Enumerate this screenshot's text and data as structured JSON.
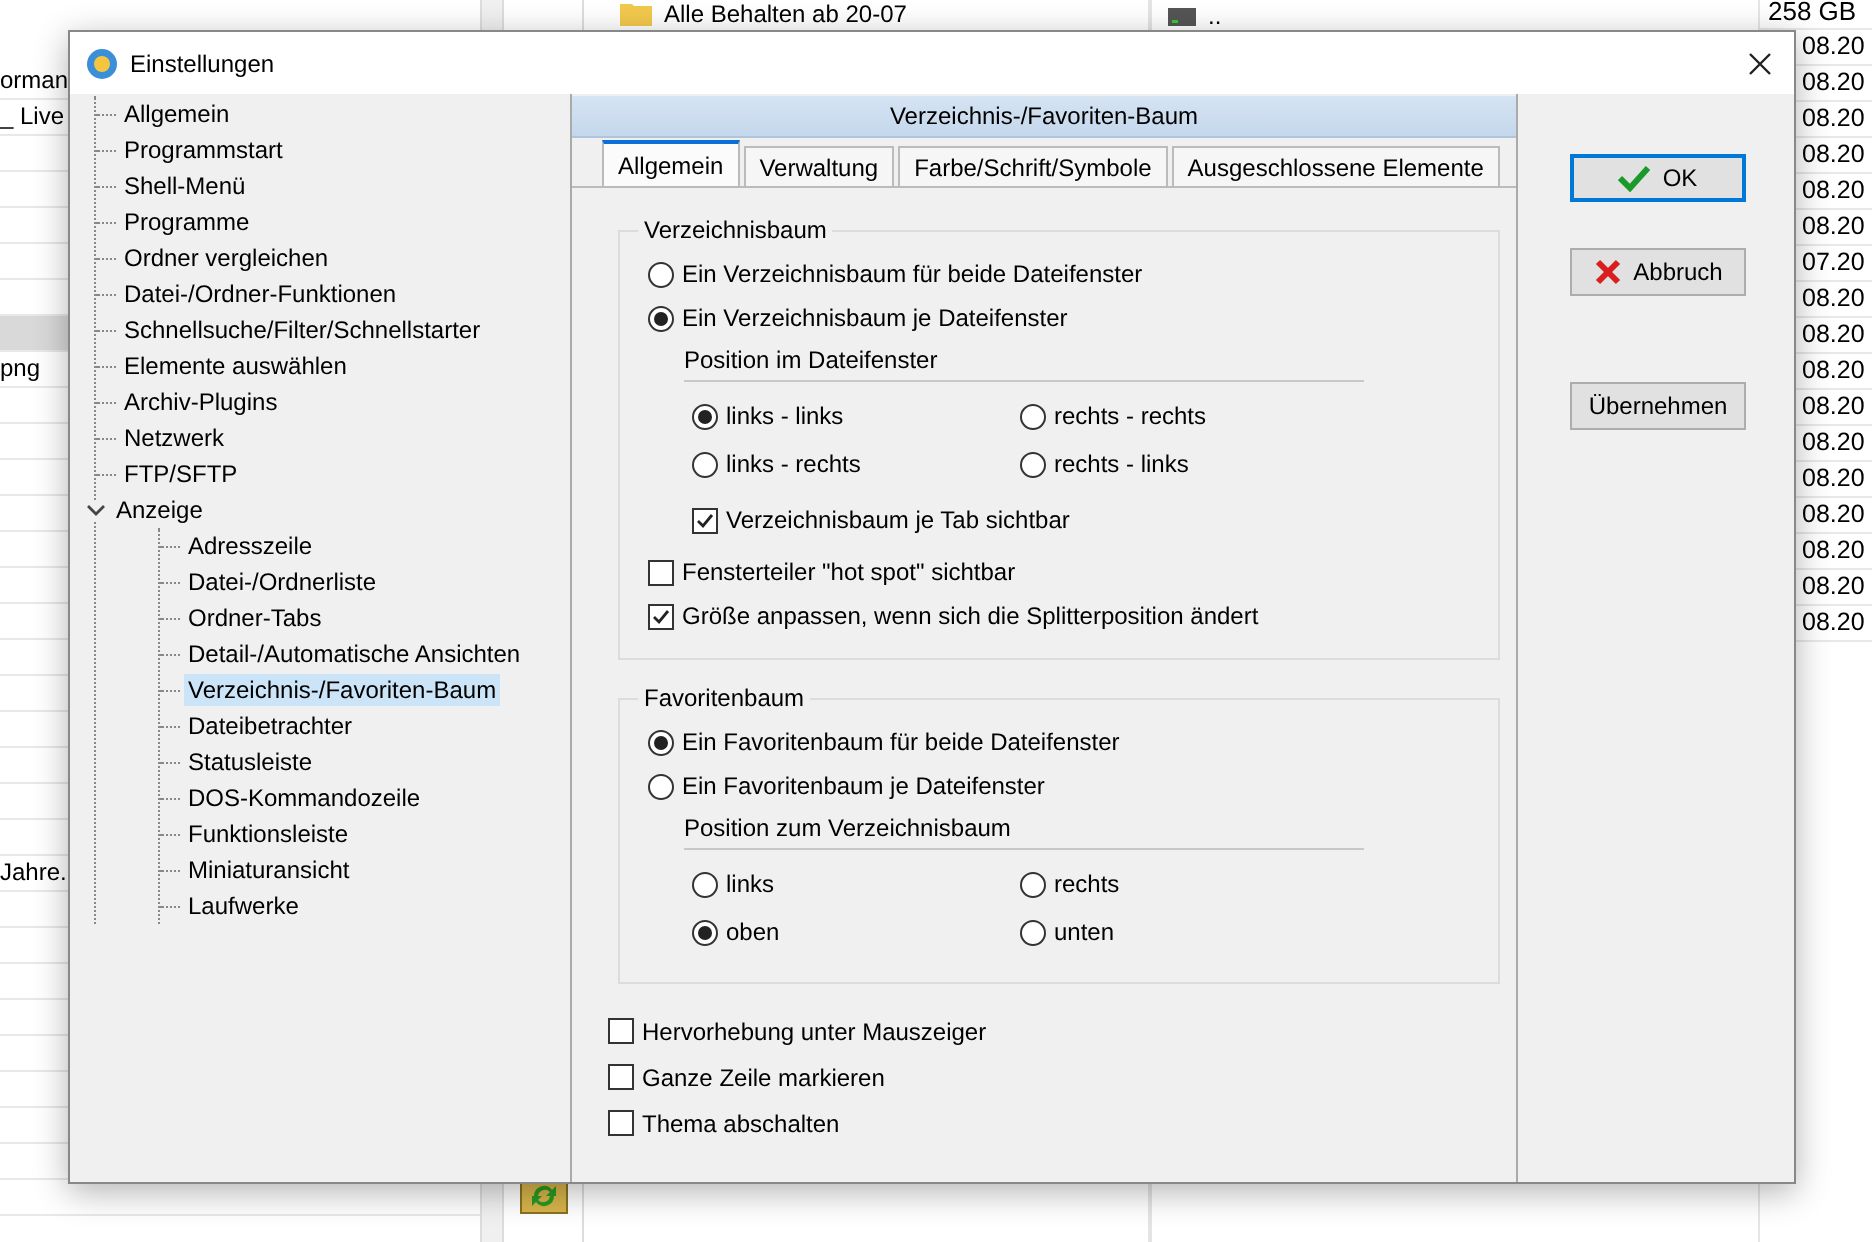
{
  "background": {
    "left_rows": [
      {
        "text": "orman",
        "selected": false
      },
      {
        "text": "_ Live",
        "selected": false
      },
      {
        "selected": false
      },
      {
        "selected": false
      },
      {
        "selected": false
      },
      {
        "selected": false
      },
      {
        "selected": false
      },
      {
        "selected": true
      },
      {
        "text": "png",
        "selected": false
      },
      {
        "selected": false
      },
      {
        "selected": false
      },
      {
        "selected": false
      },
      {
        "selected": false
      },
      {
        "selected": false
      },
      {
        "selected": false
      },
      {
        "selected": false
      },
      {
        "selected": false
      },
      {
        "selected": false
      },
      {
        "selected": false
      },
      {
        "selected": false
      },
      {
        "selected": false
      },
      {
        "selected": false
      },
      {
        "text": "Jahre.",
        "selected": false
      },
      {
        "selected": false
      },
      {
        "selected": false
      },
      {
        "selected": false
      },
      {
        "selected": false
      },
      {
        "selected": false
      },
      {
        "selected": false
      },
      {
        "selected": false
      },
      {
        "selected": false
      },
      {
        "selected": false
      }
    ],
    "folders": [
      {
        "kind": "folder",
        "name": "Alle Behalten ab 20-07"
      }
    ],
    "drive": "..",
    "size": "258 GB",
    "dates": [
      "08.20",
      "08.20",
      "08.20",
      "08.20",
      "08.20",
      "08.20",
      "07.20",
      "08.20",
      "08.20",
      "08.20",
      "08.20",
      "08.20",
      "08.20",
      "08.20",
      "08.20",
      "08.20",
      "08.20"
    ]
  },
  "dialog": {
    "title": "Einstellungen",
    "tree": [
      {
        "label": "Allgemein",
        "selected": false
      },
      {
        "label": "Programmstart",
        "selected": false
      },
      {
        "label": "Shell-Menü",
        "selected": false
      },
      {
        "label": "Programme",
        "selected": false
      },
      {
        "label": "Ordner vergleichen",
        "selected": false
      },
      {
        "label": "Datei-/Ordner-Funktionen",
        "selected": false
      },
      {
        "label": "Schnellsuche/Filter/Schnellstarter",
        "selected": false
      },
      {
        "label": "Elemente auswählen",
        "selected": false
      },
      {
        "label": "Archiv-Plugins",
        "selected": false
      },
      {
        "label": "Netzwerk",
        "selected": false
      },
      {
        "label": "FTP/SFTP",
        "selected": false
      },
      {
        "label": "Anzeige",
        "selected": false,
        "expanded": true,
        "children": [
          {
            "label": "Adresszeile",
            "selected": false
          },
          {
            "label": "Datei-/Ordnerliste",
            "selected": false
          },
          {
            "label": "Ordner-Tabs",
            "selected": false
          },
          {
            "label": "Detail-/Automatische Ansichten",
            "selected": false
          },
          {
            "label": "Verzeichnis-/Favoriten-Baum",
            "selected": true
          },
          {
            "label": "Dateibetrachter",
            "selected": false
          },
          {
            "label": "Statusleiste",
            "selected": false
          },
          {
            "label": "DOS-Kommandozeile",
            "selected": false
          },
          {
            "label": "Funktionsleiste",
            "selected": false
          },
          {
            "label": "Miniaturansicht",
            "selected": false
          },
          {
            "label": "Laufwerke",
            "selected": false
          }
        ]
      }
    ],
    "panel": {
      "header": "Verzeichnis-/Favoriten-Baum",
      "tabs": [
        {
          "label": "Allgemein",
          "selected": true
        },
        {
          "label": "Verwaltung",
          "selected": false
        },
        {
          "label": "Farbe/Schrift/Symbole",
          "selected": false
        },
        {
          "label": "Ausgeschlossene Elemente",
          "selected": false
        }
      ],
      "groups": [
        {
          "title": "Verzeichnisbaum",
          "items": [
            {
              "kind": "radio",
              "label": "Ein Verzeichnisbaum für beide Dateifenster",
              "selected": false
            },
            {
              "kind": "radio",
              "label": "Ein Verzeichnisbaum je Dateifenster",
              "selected": true
            },
            {
              "kind": "subgroup",
              "title": "Position im Dateifenster",
              "choices": [
                {
                  "label": "links - links",
                  "selected": true
                },
                {
                  "label": "rechts - rechts",
                  "selected": false
                },
                {
                  "label": "links - rechts",
                  "selected": false
                },
                {
                  "label": "rechts - links",
                  "selected": false
                }
              ],
              "checkboxes": [
                {
                  "label": "Verzeichnisbaum je Tab sichtbar",
                  "checked": true
                }
              ]
            },
            {
              "kind": "checkbox",
              "label": "Fensterteiler \"hot spot\" sichtbar",
              "checked": false
            },
            {
              "kind": "checkbox",
              "label": "Größe anpassen, wenn sich die Splitterposition ändert",
              "checked": true
            }
          ]
        },
        {
          "title": "Favoritenbaum",
          "items": [
            {
              "kind": "radio",
              "label": "Ein Favoritenbaum für beide Dateifenster",
              "selected": true
            },
            {
              "kind": "radio",
              "label": "Ein Favoritenbaum je Dateifenster",
              "selected": false
            },
            {
              "kind": "subgroup",
              "title": "Position zum Verzeichnisbaum",
              "choices": [
                {
                  "label": "links",
                  "selected": false
                },
                {
                  "label": "rechts",
                  "selected": false
                },
                {
                  "label": "oben",
                  "selected": true
                },
                {
                  "label": "unten",
                  "selected": false
                }
              ]
            }
          ]
        }
      ],
      "options": [
        {
          "label": "Hervorhebung unter Mauszeiger",
          "checked": false
        },
        {
          "label": "Ganze Zeile markieren",
          "checked": false
        },
        {
          "label": "Thema abschalten",
          "checked": false
        }
      ]
    },
    "buttons": [
      {
        "kind": "ok",
        "label": "OK"
      },
      {
        "kind": "cancel",
        "label": "Abbruch"
      },
      {
        "kind": "apply",
        "label": "Übernehmen"
      }
    ]
  }
}
